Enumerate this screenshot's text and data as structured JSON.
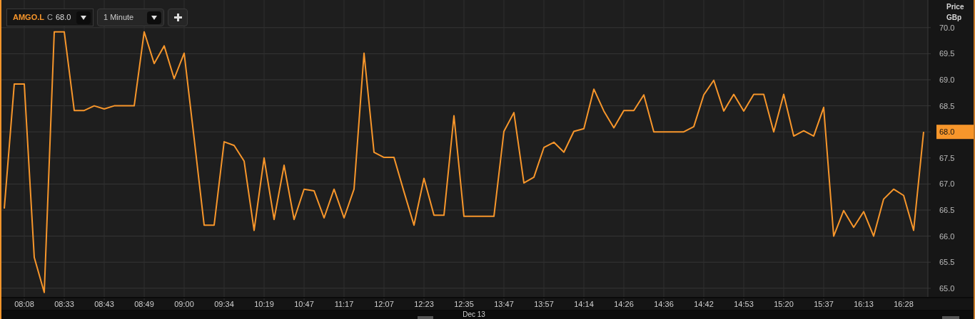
{
  "toolbar": {
    "symbol": {
      "ticker": "AMGO.L",
      "close_label": "C",
      "close_value": "68.0"
    },
    "interval": {
      "value": "1 Minute"
    }
  },
  "chart": {
    "axis_title": "Price",
    "unit": "GBp",
    "date_label": "Dec 13",
    "chart_data": {
      "type": "line",
      "categories": [
        null,
        null,
        "08:08",
        null,
        null,
        null,
        "08:33",
        null,
        null,
        null,
        "08:43",
        null,
        null,
        null,
        "08:49",
        null,
        null,
        null,
        "09:00",
        null,
        null,
        null,
        "09:34",
        null,
        null,
        null,
        "10:19",
        null,
        null,
        null,
        "10:47",
        null,
        null,
        null,
        "11:17",
        null,
        null,
        null,
        "12:07",
        null,
        null,
        null,
        "12:23",
        null,
        null,
        null,
        "12:35",
        null,
        null,
        null,
        "13:47",
        null,
        null,
        null,
        "13:57",
        null,
        null,
        null,
        "14:14",
        null,
        null,
        null,
        "14:26",
        null,
        null,
        null,
        "14:36",
        null,
        null,
        null,
        "14:42",
        null,
        null,
        null,
        "14:53",
        null,
        null,
        null,
        "15:20",
        null,
        null,
        null,
        "15:37",
        null,
        null,
        null,
        "16:13",
        null,
        null,
        null,
        "16:28",
        null,
        null
      ],
      "series": [
        {
          "color": "#f7962b",
          "values": [
            66.53,
            68.92,
            68.92,
            65.59,
            64.92,
            69.92,
            69.92,
            68.41,
            68.41,
            68.5,
            68.44,
            68.5,
            68.5,
            68.5,
            69.92,
            69.31,
            69.65,
            69.02,
            69.51,
            67.87,
            66.21,
            66.21,
            67.81,
            67.74,
            67.44,
            66.11,
            67.5,
            66.32,
            67.36,
            66.32,
            66.9,
            66.87,
            66.35,
            66.9,
            66.35,
            66.9,
            69.51,
            67.61,
            67.51,
            67.51,
            66.85,
            66.21,
            67.11,
            66.4,
            66.4,
            68.31,
            66.38,
            66.38,
            66.38,
            66.38,
            68.01,
            68.37,
            67.02,
            67.13,
            67.7,
            67.8,
            67.61,
            68.01,
            68.06,
            68.82,
            68.4,
            68.08,
            68.41,
            68.41,
            68.71,
            68.0,
            68.0,
            68.0,
            68.0,
            68.1,
            68.71,
            68.99,
            68.4,
            68.72,
            68.4,
            68.72,
            68.72,
            68.0,
            68.72,
            67.92,
            68.02,
            67.92,
            68.47,
            66.0,
            66.49,
            66.17,
            66.47,
            66.0,
            66.71,
            66.9,
            66.78,
            66.11,
            68.0
          ]
        }
      ],
      "ylim": [
        64.82,
        70.53
      ],
      "grid": true,
      "yticks": [
        {
          "value": 65,
          "label": "65.0"
        },
        {
          "value": 65.5,
          "label": "65.5"
        },
        {
          "value": 66,
          "label": "66.0"
        },
        {
          "value": 66.5,
          "label": "66.5"
        },
        {
          "value": 67,
          "label": "67.0"
        },
        {
          "value": 67.5,
          "label": "67.5"
        },
        {
          "value": 68,
          "label": "68.0"
        },
        {
          "value": 68.5,
          "label": "68.5"
        },
        {
          "value": 69,
          "label": "69.0"
        },
        {
          "value": 69.5,
          "label": "69.5"
        },
        {
          "value": 70,
          "label": "70.0"
        }
      ]
    }
  }
}
